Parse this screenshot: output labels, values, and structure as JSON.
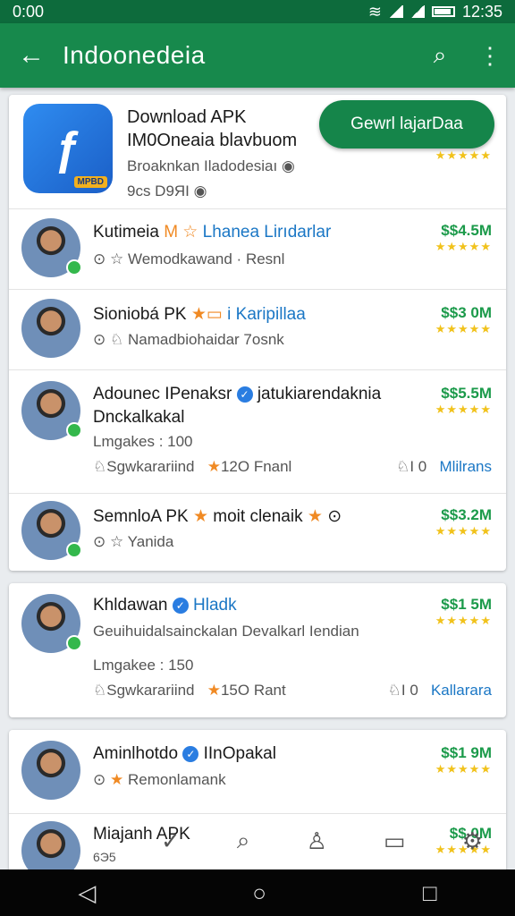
{
  "status_bar": {
    "time": "0:00",
    "clock": "12:35"
  },
  "app_bar": {
    "title": "Indoonedeia"
  },
  "featured": {
    "title_line1": "Download APK",
    "title_line2": "IM0Oneaia blavbuom",
    "subtitle": "Broaknkan Iladodesiaı",
    "size": "9cs D9ЯI",
    "logo_label": "MPBD",
    "button": "Gewrl lajarDaa"
  },
  "items": [
    {
      "name": "Kutimeia",
      "tag": "Lhanea Lirıdarlar",
      "sub1": "Wemodkawand",
      "sub2": "Resnl",
      "price": "$$4.5M"
    },
    {
      "name": "Sioniobá PK",
      "tag": "i Karipillaa",
      "sub1": "Namadbiohaidar 7osnk",
      "price": "$$3 0M"
    },
    {
      "name": "Adounec IPenaksr",
      "tag": "jatukiarendaknia",
      "line2": "Dnckalkakal",
      "meta1": "Lmgakes : 100",
      "meta2": "Sgwkarariind",
      "meta3": "12O",
      "meta4": "Fnanl",
      "meta5": "I 0",
      "meta6": "Mlilrans",
      "price": "$$5.5M"
    },
    {
      "name": "SemnloA PK",
      "tag": "moit clenaik",
      "sub1": "Yanida",
      "price": "$$3.2M"
    }
  ],
  "card2": {
    "name": "Khldawan",
    "tag": "Hladk",
    "line2": "Geuihuidalsainckalan Devalkarl Iendian",
    "meta1": "Lmgakee : 150",
    "meta2": "Sgwkarariind",
    "meta3": "15O",
    "meta4": "Rant",
    "meta5": "I 0",
    "meta6": "Kallarara",
    "price": "$$1 5M"
  },
  "card3": [
    {
      "name": "Aminlhotdo",
      "tag": "IInOpakal",
      "sub1": "Remonlamank",
      "price": "$$1 9M"
    },
    {
      "name": "Miajanh APK",
      "sub1": "6Э5",
      "price": "$$ 0M"
    }
  ],
  "stars": "★★★★★"
}
